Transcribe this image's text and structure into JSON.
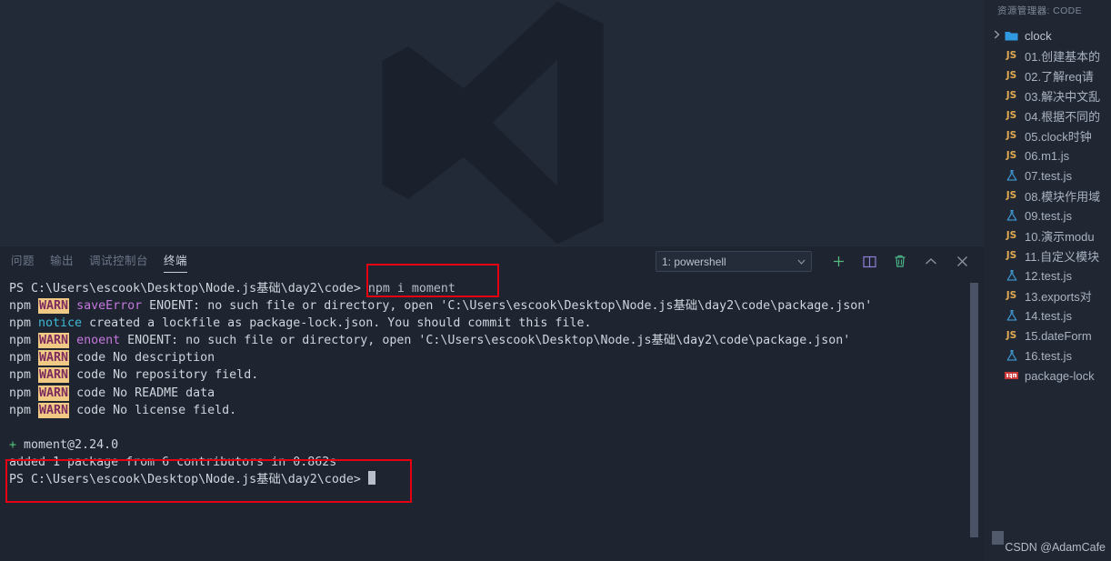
{
  "window": {
    "theme_bg": "#1e2430",
    "accent": "#e60012"
  },
  "editor": {
    "watermark_logo": "vscode-logo"
  },
  "panel": {
    "tabs": [
      {
        "label": "问题",
        "active": false
      },
      {
        "label": "输出",
        "active": false
      },
      {
        "label": "调试控制台",
        "active": false
      },
      {
        "label": "终端",
        "active": true
      }
    ],
    "terminal_select": {
      "value": "1: powershell",
      "chevron": "chevron-down-icon"
    },
    "actions": [
      {
        "name": "new-terminal-button",
        "icon": "plus-icon",
        "color": "#56b87a"
      },
      {
        "name": "split-terminal-button",
        "icon": "split-pane-icon",
        "color": "#8f7fd4"
      },
      {
        "name": "kill-terminal-button",
        "icon": "trash-icon",
        "color": "#4cb88a"
      },
      {
        "name": "maximize-panel-button",
        "icon": "chevron-up-icon",
        "color": "#8d95a5"
      },
      {
        "name": "close-panel-button",
        "icon": "close-icon",
        "color": "#8d95a5"
      }
    ]
  },
  "terminal": {
    "lines": [
      {
        "id": "prompt-1",
        "segments": [
          {
            "text": "PS C:\\Users\\escook\\Desktop\\Node.js基础\\day2\\code> ",
            "class": "c-white"
          },
          {
            "text": "npm i moment",
            "class": "c-gray"
          }
        ]
      },
      {
        "id": "warn-saveerror",
        "segments": [
          {
            "text": "npm ",
            "class": "c-white"
          },
          {
            "text": "WARN",
            "class": "warn-badge"
          },
          {
            "text": " ",
            "class": "c-white"
          },
          {
            "text": "saveError",
            "class": "c-mag"
          },
          {
            "text": " ENOENT: no such file or directory, open 'C:\\Users\\escook\\Desktop\\Node.js基础\\day2\\code\\package.json'",
            "class": "c-white"
          }
        ]
      },
      {
        "id": "notice-lockfile",
        "segments": [
          {
            "text": "npm ",
            "class": "c-white"
          },
          {
            "text": "notice",
            "class": "c-cyan"
          },
          {
            "text": " created a lockfile as package-lock.json. You should commit this file.",
            "class": "c-white"
          }
        ]
      },
      {
        "id": "warn-enoent",
        "segments": [
          {
            "text": "npm ",
            "class": "c-white"
          },
          {
            "text": "WARN",
            "class": "warn-badge"
          },
          {
            "text": " ",
            "class": "c-white"
          },
          {
            "text": "enoent",
            "class": "c-mag"
          },
          {
            "text": " ENOENT: no such file or directory, open 'C:\\Users\\escook\\Desktop\\Node.js基础\\day2\\code\\package.json'",
            "class": "c-white"
          }
        ]
      },
      {
        "id": "warn-no-description",
        "segments": [
          {
            "text": "npm ",
            "class": "c-white"
          },
          {
            "text": "WARN",
            "class": "warn-badge"
          },
          {
            "text": " code No description",
            "class": "c-white"
          }
        ]
      },
      {
        "id": "warn-no-repository",
        "segments": [
          {
            "text": "npm ",
            "class": "c-white"
          },
          {
            "text": "WARN",
            "class": "warn-badge"
          },
          {
            "text": " code No repository field.",
            "class": "c-white"
          }
        ]
      },
      {
        "id": "warn-no-readme",
        "segments": [
          {
            "text": "npm ",
            "class": "c-white"
          },
          {
            "text": "WARN",
            "class": "warn-badge"
          },
          {
            "text": " code No README data",
            "class": "c-white"
          }
        ]
      },
      {
        "id": "warn-no-license",
        "segments": [
          {
            "text": "npm ",
            "class": "c-white"
          },
          {
            "text": "WARN",
            "class": "warn-badge"
          },
          {
            "text": " code No license field.",
            "class": "c-white"
          }
        ]
      },
      {
        "id": "blank-1",
        "segments": []
      },
      {
        "id": "installed-package",
        "segments": [
          {
            "text": "+ ",
            "class": "c-green"
          },
          {
            "text": "moment@2.24.0",
            "class": "c-white"
          }
        ]
      },
      {
        "id": "added-summary",
        "segments": [
          {
            "text": "added 1 package from 6 contributors in 0.862s",
            "class": "c-white"
          }
        ]
      },
      {
        "id": "prompt-2",
        "segments": [
          {
            "text": "PS C:\\Users\\escook\\Desktop\\Node.js基础\\day2\\code> ",
            "class": "c-white"
          }
        ],
        "cursor": true
      }
    ]
  },
  "annotations": [
    {
      "name": "annotation-box-command",
      "color": "#e60012"
    },
    {
      "name": "annotation-box-result",
      "color": "#e60012"
    }
  ],
  "sidebar": {
    "title": "资源管理器: CODE",
    "tree": [
      {
        "name": "clock",
        "icon": "folder-icon",
        "type": "folder",
        "expandable": true,
        "twisty": "chevron-right-icon"
      },
      {
        "name": "01.创建基本的",
        "icon": "js-file-icon",
        "type": "js"
      },
      {
        "name": "02.了解req请",
        "icon": "js-file-icon",
        "type": "js"
      },
      {
        "name": "03.解决中文乱",
        "icon": "js-file-icon",
        "type": "js"
      },
      {
        "name": "04.根据不同的",
        "icon": "js-file-icon",
        "type": "js"
      },
      {
        "name": "05.clock时钟",
        "icon": "js-file-icon",
        "type": "js"
      },
      {
        "name": "06.m1.js",
        "icon": "js-file-icon",
        "type": "js"
      },
      {
        "name": "07.test.js",
        "icon": "test-flask-icon",
        "type": "test"
      },
      {
        "name": "08.模块作用域",
        "icon": "js-file-icon",
        "type": "js"
      },
      {
        "name": "09.test.js",
        "icon": "test-flask-icon",
        "type": "test"
      },
      {
        "name": "10.演示modu",
        "icon": "js-file-icon",
        "type": "js"
      },
      {
        "name": "11.自定义模块",
        "icon": "js-file-icon",
        "type": "js"
      },
      {
        "name": "12.test.js",
        "icon": "test-flask-icon",
        "type": "test"
      },
      {
        "name": "13.exports对",
        "icon": "js-file-icon",
        "type": "js"
      },
      {
        "name": "14.test.js",
        "icon": "test-flask-icon",
        "type": "test"
      },
      {
        "name": "15.dateForm",
        "icon": "js-file-icon",
        "type": "js"
      },
      {
        "name": "16.test.js",
        "icon": "test-flask-icon",
        "type": "test"
      },
      {
        "name": "package-lock",
        "icon": "npm-icon",
        "type": "npm"
      }
    ]
  },
  "watermark": {
    "text": "CSDN @AdamCafe"
  }
}
